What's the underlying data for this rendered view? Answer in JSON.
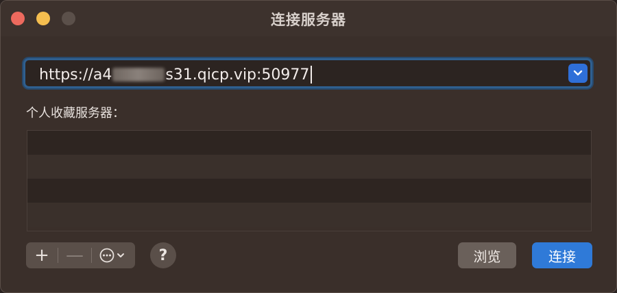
{
  "window": {
    "title": "连接服务器"
  },
  "address": {
    "prefix": "https://a4",
    "suffix": "s31.qicp.vip:50977"
  },
  "favorites": {
    "label": "个人收藏服务器：",
    "rows": 4
  },
  "toolbar": {
    "add_symbol": "+",
    "remove_symbol": "—",
    "help_symbol": "?"
  },
  "buttons": {
    "browse_label": "浏览",
    "connect_label": "连接"
  },
  "colors": {
    "accent": "#2f7ad8",
    "close": "#ed6a5e",
    "minimize": "#f5be4f"
  }
}
